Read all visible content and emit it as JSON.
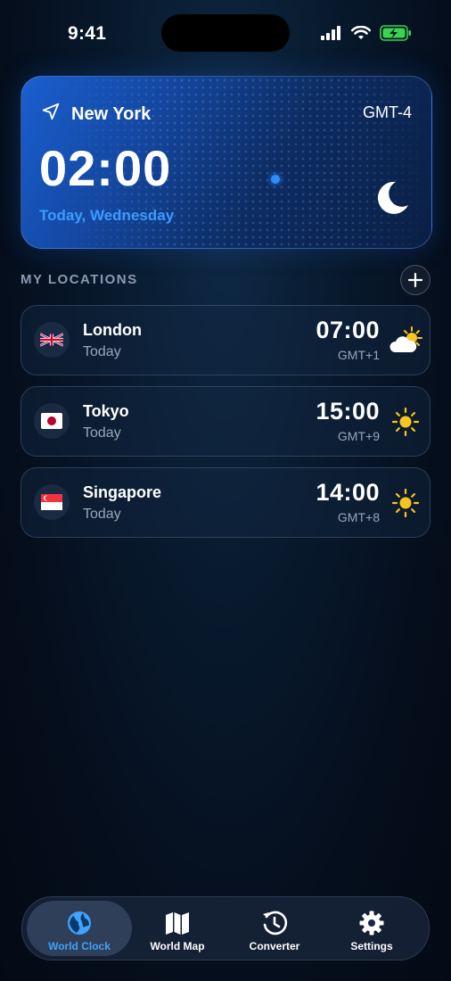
{
  "status_bar": {
    "time": "9:41"
  },
  "hero": {
    "city": "New York",
    "gmt": "GMT-4",
    "time": "02:00",
    "date": "Today, Wednesday",
    "condition_icon": "moon-icon",
    "accent_color": "#3d9bff"
  },
  "locations_section": {
    "title": "MY LOCATIONS"
  },
  "locations": [
    {
      "city": "London",
      "day": "Today",
      "time": "07:00",
      "gmt": "GMT+1",
      "flag": "uk-flag",
      "weather": "partly-cloudy-icon"
    },
    {
      "city": "Tokyo",
      "day": "Today",
      "time": "15:00",
      "gmt": "GMT+9",
      "flag": "japan-flag",
      "weather": "sun-icon"
    },
    {
      "city": "Singapore",
      "day": "Today",
      "time": "14:00",
      "gmt": "GMT+8",
      "flag": "singapore-flag",
      "weather": "sun-icon"
    }
  ],
  "tabs": [
    {
      "label": "World Clock",
      "icon": "globe-icon",
      "active": true
    },
    {
      "label": "World Map",
      "icon": "map-icon",
      "active": false
    },
    {
      "label": "Converter",
      "icon": "history-clock-icon",
      "active": false
    },
    {
      "label": "Settings",
      "icon": "gear-icon",
      "active": false
    }
  ]
}
